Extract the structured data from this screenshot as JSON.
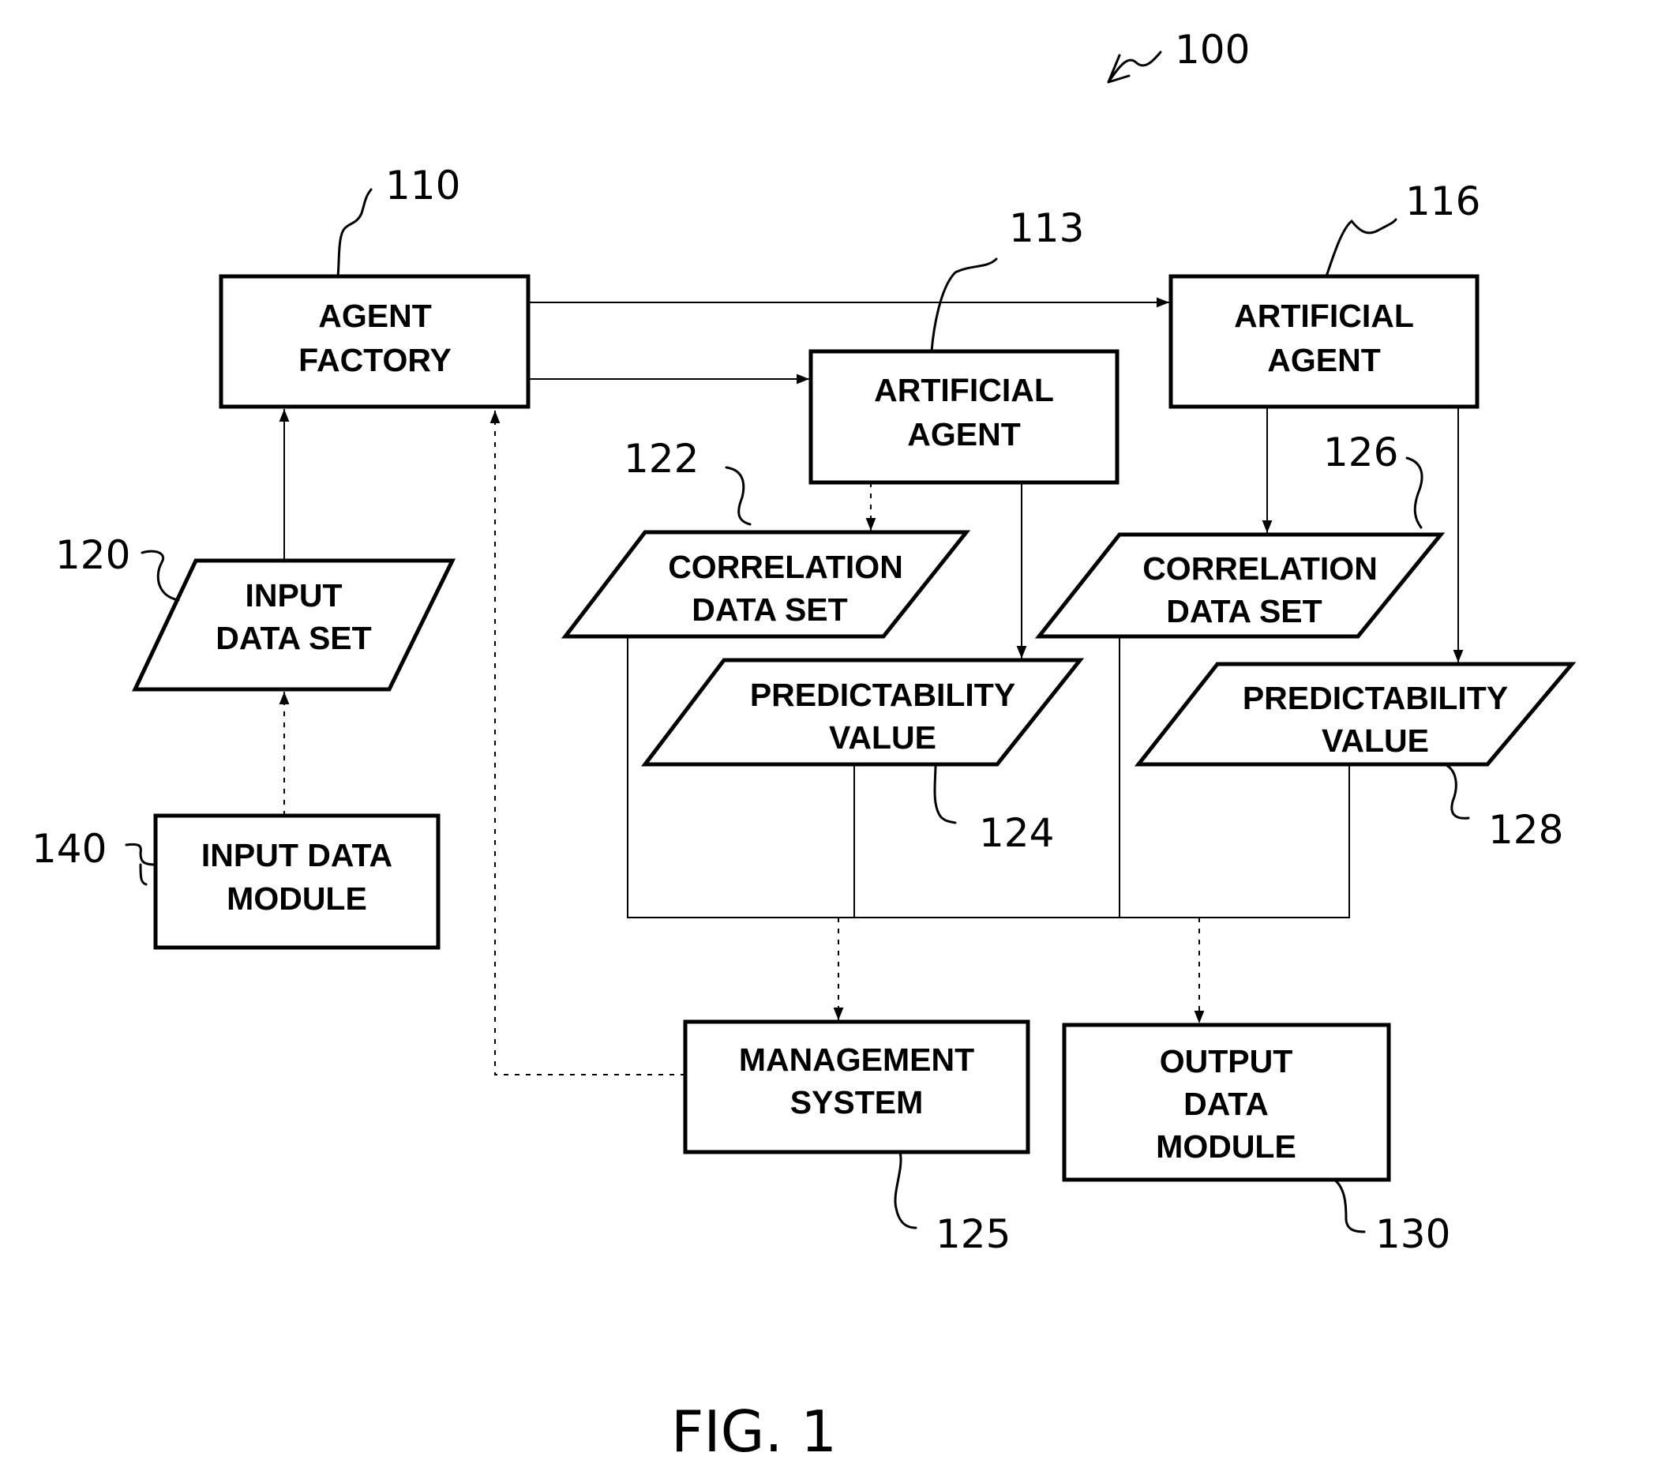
{
  "figure": {
    "reference": "100",
    "caption": "FIG. 1"
  },
  "nodes": {
    "agent_factory": {
      "ref": "110",
      "lines": [
        "AGENT",
        "FACTORY"
      ]
    },
    "artificial_agent_1": {
      "ref": "113",
      "lines": [
        "ARTIFICIAL",
        "AGENT"
      ]
    },
    "artificial_agent_2": {
      "ref": "116",
      "lines": [
        "ARTIFICIAL",
        "AGENT"
      ]
    },
    "input_data_set": {
      "ref": "120",
      "lines": [
        "INPUT",
        "DATA SET"
      ]
    },
    "correlation_data_set_1": {
      "ref": "122",
      "lines": [
        "CORRELATION",
        "DATA SET"
      ]
    },
    "predictability_value_1": {
      "ref": "124",
      "lines": [
        "PREDICTABILITY",
        "VALUE"
      ]
    },
    "correlation_data_set_2": {
      "ref": "126",
      "lines": [
        "CORRELATION",
        "DATA SET"
      ]
    },
    "predictability_value_2": {
      "ref": "128",
      "lines": [
        "PREDICTABILITY",
        "VALUE"
      ]
    },
    "input_data_module": {
      "ref": "140",
      "lines": [
        "INPUT DATA",
        "MODULE"
      ]
    },
    "management_system": {
      "ref": "125",
      "lines": [
        "MANAGEMENT",
        "SYSTEM"
      ]
    },
    "output_data_module": {
      "ref": "130",
      "lines": [
        "OUTPUT",
        "DATA",
        "MODULE"
      ]
    }
  },
  "edges": [
    {
      "from": "agent_factory",
      "to": "artificial_agent_2",
      "style": "solid"
    },
    {
      "from": "agent_factory",
      "to": "artificial_agent_1",
      "style": "solid"
    },
    {
      "from": "input_data_set",
      "to": "agent_factory",
      "style": "solid"
    },
    {
      "from": "input_data_module",
      "to": "input_data_set",
      "style": "dashed"
    },
    {
      "from": "artificial_agent_1",
      "to": "correlation_data_set_1",
      "style": "dashed"
    },
    {
      "from": "artificial_agent_1",
      "to": "predictability_value_1",
      "style": "solid"
    },
    {
      "from": "artificial_agent_2",
      "to": "correlation_data_set_2",
      "style": "solid"
    },
    {
      "from": "artificial_agent_2",
      "to": "predictability_value_2",
      "style": "solid"
    },
    {
      "from": "output_bus",
      "to": "management_system",
      "style": "dashed"
    },
    {
      "from": "output_bus",
      "to": "output_data_module",
      "style": "dashed"
    },
    {
      "from": "management_system",
      "to": "agent_factory",
      "style": "dashed"
    }
  ]
}
